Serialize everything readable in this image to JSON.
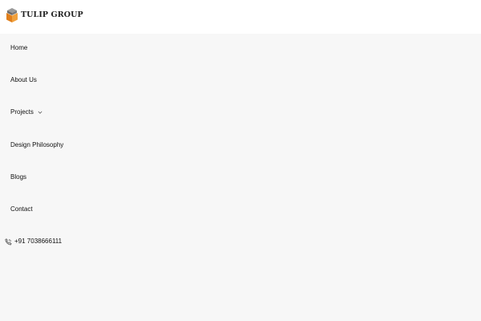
{
  "brand": {
    "name": "TULIP GROUP",
    "logo_icon": "tulip-cube-logo",
    "colors": {
      "logo_orange": "#e8902a",
      "logo_gray": "#8a8a8a",
      "logo_dark": "#5a5a5a"
    }
  },
  "menu": {
    "items": [
      {
        "label": "Home"
      },
      {
        "label": "About Us"
      },
      {
        "label": "Projects",
        "icon": "chevron-down-icon"
      },
      {
        "label": "Design Philosophy"
      },
      {
        "label": "Blogs"
      },
      {
        "label": "Contact"
      }
    ]
  },
  "contact": {
    "phone": "+91 7038666111",
    "icon": "phone-icon"
  },
  "colors": {
    "header_bg": "#ffffff",
    "page_bg": "#f7f7f7",
    "text": "#111111"
  }
}
